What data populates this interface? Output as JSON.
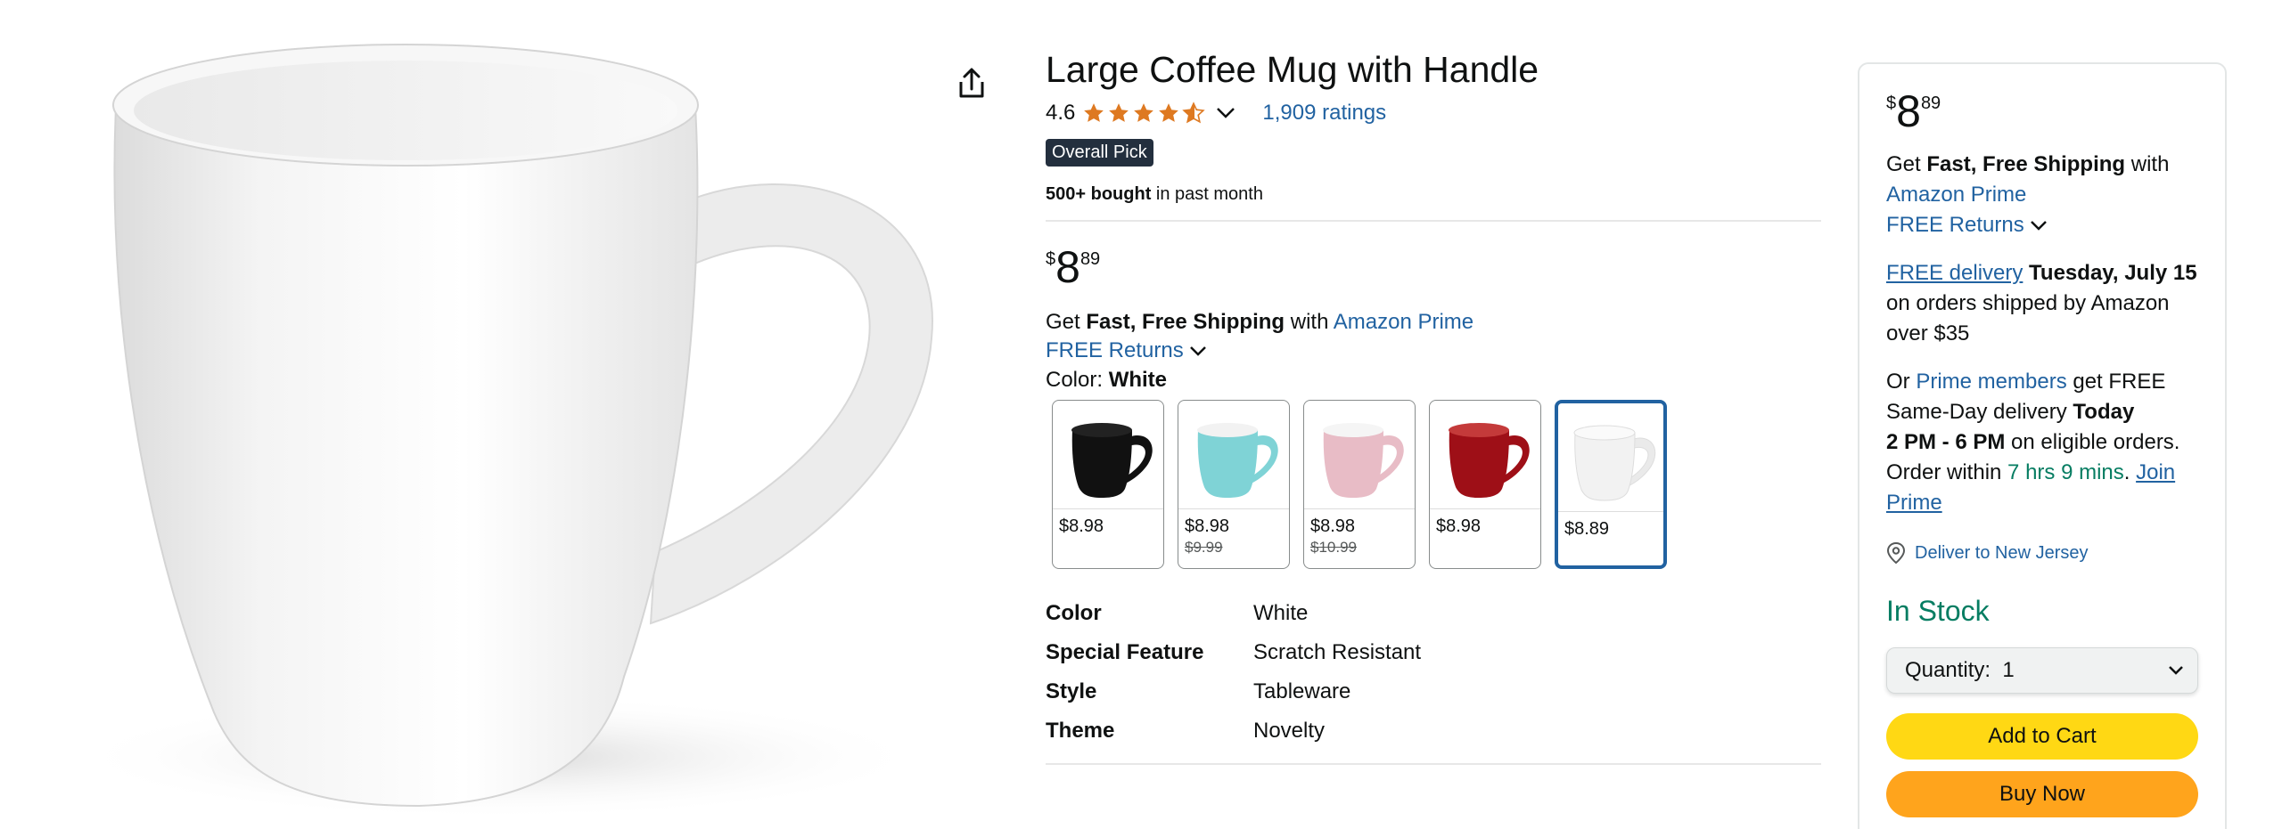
{
  "product": {
    "title": "Large Coffee Mug with Handle",
    "rating": "4.6",
    "ratings_count": "1,909 ratings",
    "badge": "Overall Pick",
    "bought_bold": "500+ bought",
    "bought_rest": " in past month"
  },
  "price": {
    "symbol": "$",
    "whole": "8",
    "fraction": "89"
  },
  "shipping": {
    "get": "Get ",
    "fast_free": "Fast, Free Shipping",
    "with": " with ",
    "prime_link": "Amazon Prime",
    "returns": "FREE Returns"
  },
  "color": {
    "label": "Color: ",
    "value": "White"
  },
  "swatches": [
    {
      "name": "Black",
      "price": "$8.98",
      "old_price": "",
      "color": "#111111"
    },
    {
      "name": "Turquoise",
      "price": "$8.98",
      "old_price": "$9.99",
      "color": "#7fd3d6"
    },
    {
      "name": "Pink",
      "price": "$8.98",
      "old_price": "$10.99",
      "color": "#e8bcc6"
    },
    {
      "name": "Red",
      "price": "$8.98",
      "old_price": "",
      "color": "#9e0f17"
    },
    {
      "name": "White",
      "price": "$8.89",
      "old_price": "",
      "color": "#f2f2f2"
    }
  ],
  "specs": [
    {
      "key": "Color",
      "value": "White"
    },
    {
      "key": "Special Feature",
      "value": "Scratch Resistant"
    },
    {
      "key": "Style",
      "value": "Tableware"
    },
    {
      "key": "Theme",
      "value": "Novelty"
    }
  ],
  "buybox": {
    "delivery_link": "FREE delivery",
    "delivery_date": "Tuesday, July 15",
    "delivery_rest": "on orders shipped by Amazon over $35",
    "or": "Or ",
    "prime_members": "Prime members",
    "get_free": " get FREE Same-Day delivery ",
    "today": "Today",
    "time_window": "2 PM - 6 PM",
    "eligible": " on eligible orders. Order within ",
    "countdown": "7 hrs 9 mins",
    "period": ". ",
    "join_prime": "Join Prime",
    "deliver_to": "Deliver to New Jersey",
    "stock": "In Stock",
    "quantity_label": "Quantity:",
    "quantity_value": "1",
    "add_to_cart": "Add to Cart",
    "buy_now": "Buy Now"
  },
  "colors": {
    "link": "#2162a1",
    "green": "#067d62",
    "cart": "#ffd814",
    "buy": "#ffa41c",
    "star": "#de7921"
  }
}
